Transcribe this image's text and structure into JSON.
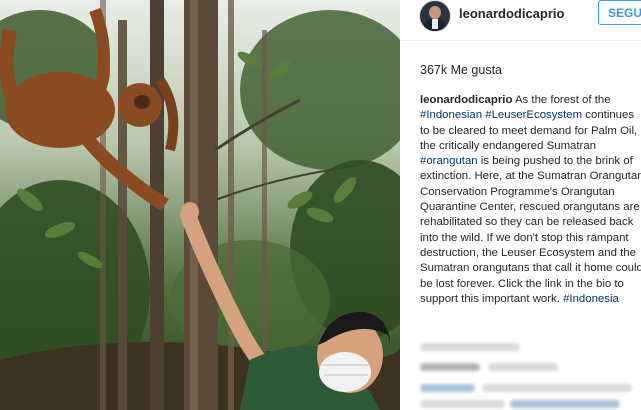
{
  "post": {
    "photo_alt": "Man in face mask reaching up to an orangutan in a forest"
  },
  "header": {
    "username": "leonardodicaprio",
    "follow_label": "SEGUI"
  },
  "likes": {
    "text": "367k Me gusta"
  },
  "caption": {
    "author": "leonardodicaprio",
    "t1": " As the forest of the ",
    "tag_indonesian": "#Indonesian",
    "sp1": " ",
    "tag_leuser": "#LeuserEcosystem",
    "t2": " continues to be cleared to meet demand for Palm Oil, the critically endangered Sumatran ",
    "tag_orangutan": "#orangutan",
    "t3": " is being pushed to the brink of extinction. Here, at the Sumatran Orangutan Conservation Programme's Orangutan Quarantine Center, rescued orangutans are rehabilitated so they can be released back into the wild. If we don't stop this rampant destruction, the Leuser Ecosystem and the Sumatran orangutans that call it home could be lost forever. Click the link in the bio to support this important work. ",
    "tag_indonesia": "#Indonesia"
  },
  "colors": {
    "follow_blue": "#3897f0",
    "hashtag": "#003569",
    "text": "#262626"
  }
}
